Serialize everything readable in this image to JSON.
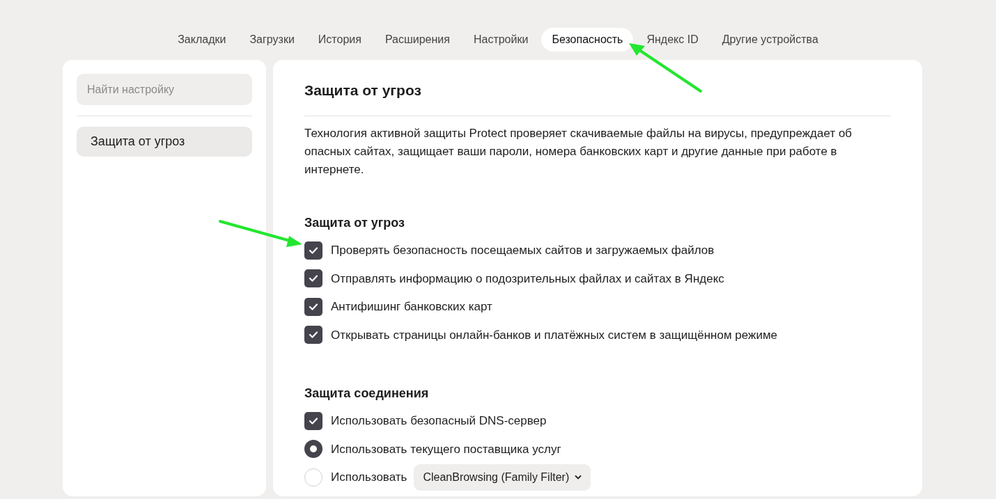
{
  "tabs": [
    {
      "label": "Закладки",
      "selected": false
    },
    {
      "label": "Загрузки",
      "selected": false
    },
    {
      "label": "История",
      "selected": false
    },
    {
      "label": "Расширения",
      "selected": false
    },
    {
      "label": "Настройки",
      "selected": false
    },
    {
      "label": "Безопасность",
      "selected": true
    },
    {
      "label": "Яндекс ID",
      "selected": false
    },
    {
      "label": "Другие устройства",
      "selected": false
    }
  ],
  "sidebar": {
    "search": {
      "placeholder": "Найти настройку"
    },
    "items": [
      {
        "label": "Защита от угроз",
        "selected": true
      }
    ]
  },
  "content": {
    "title": "Защита от угроз",
    "description": "Технология активной защиты Protect проверяет скачиваемые файлы на вирусы, предупреждает об опасных сайтах, защищает ваши пароли, номера банковских карт и другие данные при работе в интернете.",
    "sections": [
      {
        "heading": "Защита от угроз",
        "options": [
          {
            "kind": "checkbox",
            "label": "Проверять безопасность посещаемых сайтов и загружаемых файлов",
            "checked": true
          },
          {
            "kind": "checkbox",
            "label": "Отправлять информацию о подозрительных файлах и сайтах в Яндекс",
            "checked": true
          },
          {
            "kind": "checkbox",
            "label": "Антифишинг банковских карт",
            "checked": true
          },
          {
            "kind": "checkbox",
            "label": "Открывать страницы онлайн-банков и платёжных систем в защищённом режиме",
            "checked": true
          }
        ]
      },
      {
        "heading": "Защита соединения",
        "options": [
          {
            "kind": "checkbox",
            "label": "Использовать безопасный DNS-сервер",
            "checked": true
          },
          {
            "kind": "radio",
            "label": "Использовать текущего поставщика услуг",
            "selected": true
          },
          {
            "kind": "radio_select",
            "label": "Использовать",
            "selected": false,
            "value": "CleanBrowsing (Family Filter)"
          }
        ]
      }
    ]
  }
}
